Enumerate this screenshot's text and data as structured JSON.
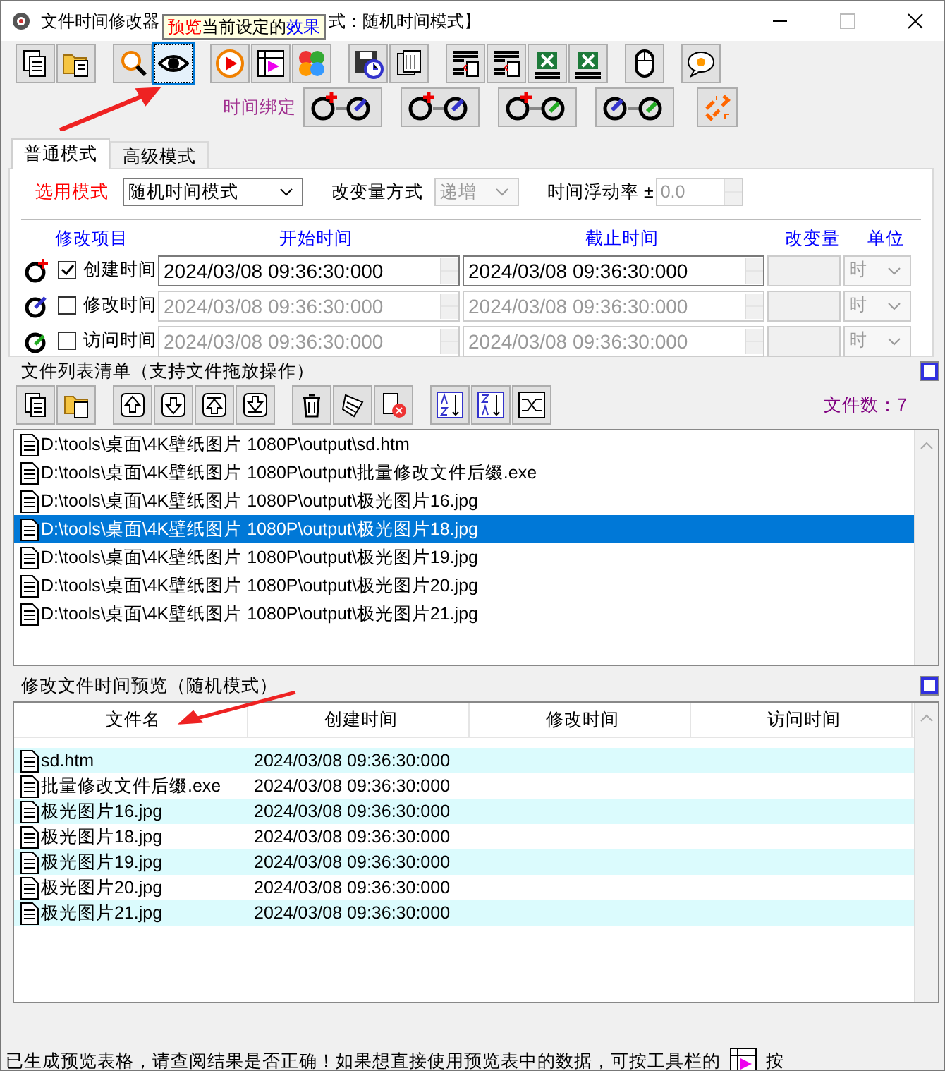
{
  "window": {
    "title": "文件时间修改器",
    "title_tail": "式：随机时间模式】"
  },
  "tooltip": [
    {
      "text": "预览",
      "color": "#ff0000"
    },
    {
      "text": "当前设定的",
      "color": "#000000"
    },
    {
      "text": "效果",
      "color": "#0000ff"
    }
  ],
  "toolbar": [
    {
      "selected": false
    },
    {
      "selected": false
    },
    {
      "selected": false
    },
    {
      "selected": true
    },
    {
      "selected": false
    },
    {
      "selected": false
    },
    {
      "selected": false
    },
    {
      "selected": false
    },
    {
      "selected": false
    },
    {
      "selected": false
    },
    {
      "selected": false
    },
    {
      "selected": false
    },
    {
      "selected": false
    },
    {
      "selected": false
    },
    {
      "selected": false
    }
  ],
  "binding": {
    "label": "时间绑定"
  },
  "tabs": [
    {
      "label": "普通模式",
      "selected": true
    },
    {
      "label": "高级模式",
      "selected": false
    }
  ],
  "mode": {
    "label": "选用模式",
    "value": "随机时间模式",
    "change_label": "改变量方式",
    "change_value": "递增",
    "float_label": "时间浮动率 ±",
    "float_value": "0.0"
  },
  "time_columns": [
    "修改项目",
    "开始时间",
    "截止时间",
    "改变量",
    "单位"
  ],
  "time_rows": [
    {
      "label": "创建时间",
      "checked": true,
      "start": "2024/03/08 09:36:30:000",
      "end": "2024/03/08 09:36:30:000",
      "unit": "时"
    },
    {
      "label": "修改时间",
      "checked": false,
      "start": "2024/03/08 09:36:30:000",
      "end": "2024/03/08 09:36:30:000",
      "unit": "时"
    },
    {
      "label": "访问时间",
      "checked": false,
      "start": "2024/03/08 09:36:30:000",
      "end": "2024/03/08 09:36:30:000",
      "unit": "时"
    }
  ],
  "file_list": {
    "title": "文件列表清单（支持文件拖放操作）",
    "count": "文件数：7",
    "items": [
      {
        "path": "D:\\tools\\桌面\\4K壁纸图片 1080P\\output\\sd.htm",
        "selected": false
      },
      {
        "path": "D:\\tools\\桌面\\4K壁纸图片 1080P\\output\\批量修改文件后缀.exe",
        "selected": false
      },
      {
        "path": "D:\\tools\\桌面\\4K壁纸图片 1080P\\output\\极光图片16.jpg",
        "selected": false
      },
      {
        "path": "D:\\tools\\桌面\\4K壁纸图片 1080P\\output\\极光图片18.jpg",
        "selected": true
      },
      {
        "path": "D:\\tools\\桌面\\4K壁纸图片 1080P\\output\\极光图片19.jpg",
        "selected": false
      },
      {
        "path": "D:\\tools\\桌面\\4K壁纸图片 1080P\\output\\极光图片20.jpg",
        "selected": false
      },
      {
        "path": "D:\\tools\\桌面\\4K壁纸图片 1080P\\output\\极光图片21.jpg",
        "selected": false
      }
    ]
  },
  "preview": {
    "title": "修改文件时间预览（随机模式）",
    "columns": [
      "文件名",
      "创建时间",
      "修改时间",
      "访问时间"
    ],
    "rows": [
      {
        "name": "sd.htm",
        "created": "2024/03/08 09:36:30:000"
      },
      {
        "name": "批量修改文件后缀.exe",
        "created": "2024/03/08 09:36:30:000"
      },
      {
        "name": "极光图片16.jpg",
        "created": "2024/03/08 09:36:30:000"
      },
      {
        "name": "极光图片18.jpg",
        "created": "2024/03/08 09:36:30:000"
      },
      {
        "name": "极光图片19.jpg",
        "created": "2024/03/08 09:36:30:000"
      },
      {
        "name": "极光图片20.jpg",
        "created": "2024/03/08 09:36:30:000"
      },
      {
        "name": "极光图片21.jpg",
        "created": "2024/03/08 09:36:30:000"
      }
    ]
  },
  "status_bar": {
    "text": "已生成预览表格，请查阅结果是否正确！如果想直接使用预览表中的数据，可按工具栏的",
    "tail": "按"
  },
  "annotations": [
    {
      "kind": "arrow"
    },
    {
      "kind": "arrow"
    }
  ]
}
